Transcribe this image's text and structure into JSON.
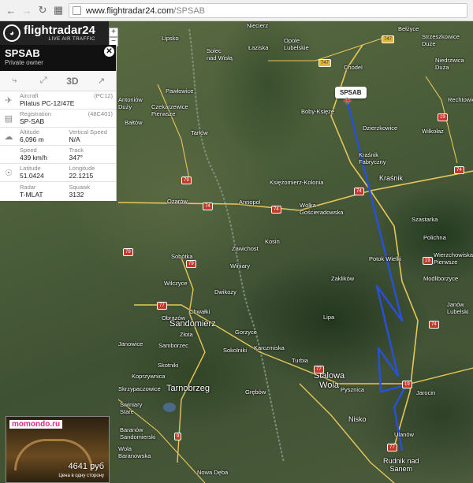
{
  "browser": {
    "url_host": "www.flightradar24.com",
    "url_path": "/SPSAB"
  },
  "logo": {
    "name": "flightradar24",
    "tagline": "LIVE AIR TRAFFIC"
  },
  "zoom": {
    "in": "+",
    "out": "−"
  },
  "flight": {
    "callsign": "SPSAB",
    "owner": "Private owner",
    "toolbar_3d": "3D",
    "aircraft_label": "Aircraft",
    "aircraft_code": "(PC12)",
    "aircraft_value": "Pilatus PC-12/47E",
    "registration_label": "Registration",
    "registration_code": "(48C401)",
    "registration_value": "SP-SAB",
    "altitude_label": "Altitude",
    "altitude_value": "6,096 m",
    "vspeed_label": "Vertical Speed",
    "vspeed_value": "N/A",
    "speed_label": "Speed",
    "speed_value": "439 km/h",
    "track_label": "Track",
    "track_value": "347°",
    "latitude_label": "Latitude",
    "latitude_value": "51.0424",
    "longitude_label": "Longitude",
    "longitude_value": "22.1215",
    "radar_label": "Radar",
    "radar_value": "T-MLAT",
    "squawk_label": "Squawk",
    "squawk_value": "3132"
  },
  "map": {
    "callsign_tag": "SPSAB",
    "places": {
      "lipsko": "Lipsko",
      "solec": "Solec\nnad Wisłą",
      "niecierz": "Niecierz",
      "laziska": "Łaziska",
      "opole": "Opole\nLubelskie",
      "belzyce": "Bełżyce",
      "strzeszkowice": "Strzeszkowice\nDuże",
      "chodel": "Chodel",
      "niedrzwica": "Niedrzwica\nDuża",
      "pawlowice": "Pawłowice",
      "antoniow": "Antoniów\nDuży",
      "czekarzewice": "Czekarzewice\nPierwsze",
      "baltow": "Bałtów",
      "boby": "Boby-Księże",
      "tarlow": "Tarłów",
      "dzierzkowice": "Dzierzkowice",
      "wilkolaz": "Wilkołaz",
      "rechtowice": "Rechtowice",
      "krasnik_fabryczny": "Kraśnik\nFabryczny",
      "ksiezomierz": "Księżomierz-Kolonia",
      "krasnik": "Kraśnik",
      "ozarow": "Ożarów",
      "annopol": "Annopol",
      "wolka": "Wólka\nGościeradowska",
      "szastarka": "Szastarka",
      "polichna": "Polichna",
      "kosin": "Kosin",
      "zawichost": "Zawichost",
      "potok_wielki": "Potok Wielki",
      "wierzchowiska": "Wierzchowiska\nPierwsze",
      "sobotka": "Sobótka",
      "winiary": "Winiary",
      "zaklikow": "Zaklików",
      "modliborzyce": "Modliborzyce",
      "wilczyce": "Wilczyce",
      "dwikozy": "Dwikozy",
      "janow": "Janów\nLubelski",
      "chwalki": "Chwałki",
      "obrazow": "Obrazów",
      "sandomierz": "Sandomierz",
      "lipa": "Lipa",
      "zlota": "Złota",
      "janowice": "Janowice",
      "samborzec": "Samborzec",
      "sokolniki": "Sokolniki",
      "karczmiska": "Karczmiska",
      "gorzyce": "Gorzyce",
      "turbia": "Turbia",
      "skotniki": "Skotniki",
      "koprzywnica": "Koprzywnica",
      "skrzypaczowice": "Skrzypaczowice",
      "tarnobrzeg": "Tarnobrzeg",
      "stalowa_wola": "Stalowa\nWola",
      "pysznica": "Pysznica",
      "jarocin": "Jarocin",
      "grebow": "Grębów",
      "swiniary": "Świniary\nStare",
      "baranow": "Baranów\nSandomierski",
      "nisko": "Nisko",
      "ulanow": "Ulanów",
      "wola_baranowska": "Wola\nBaranowska",
      "rudnik": "Rudnik nad\nSanem",
      "nowa_deba": "Nowa Dęba"
    }
  },
  "ad": {
    "brand": "momondo.ru",
    "price": "4641 руб",
    "note": "Цена в одну сторону"
  }
}
